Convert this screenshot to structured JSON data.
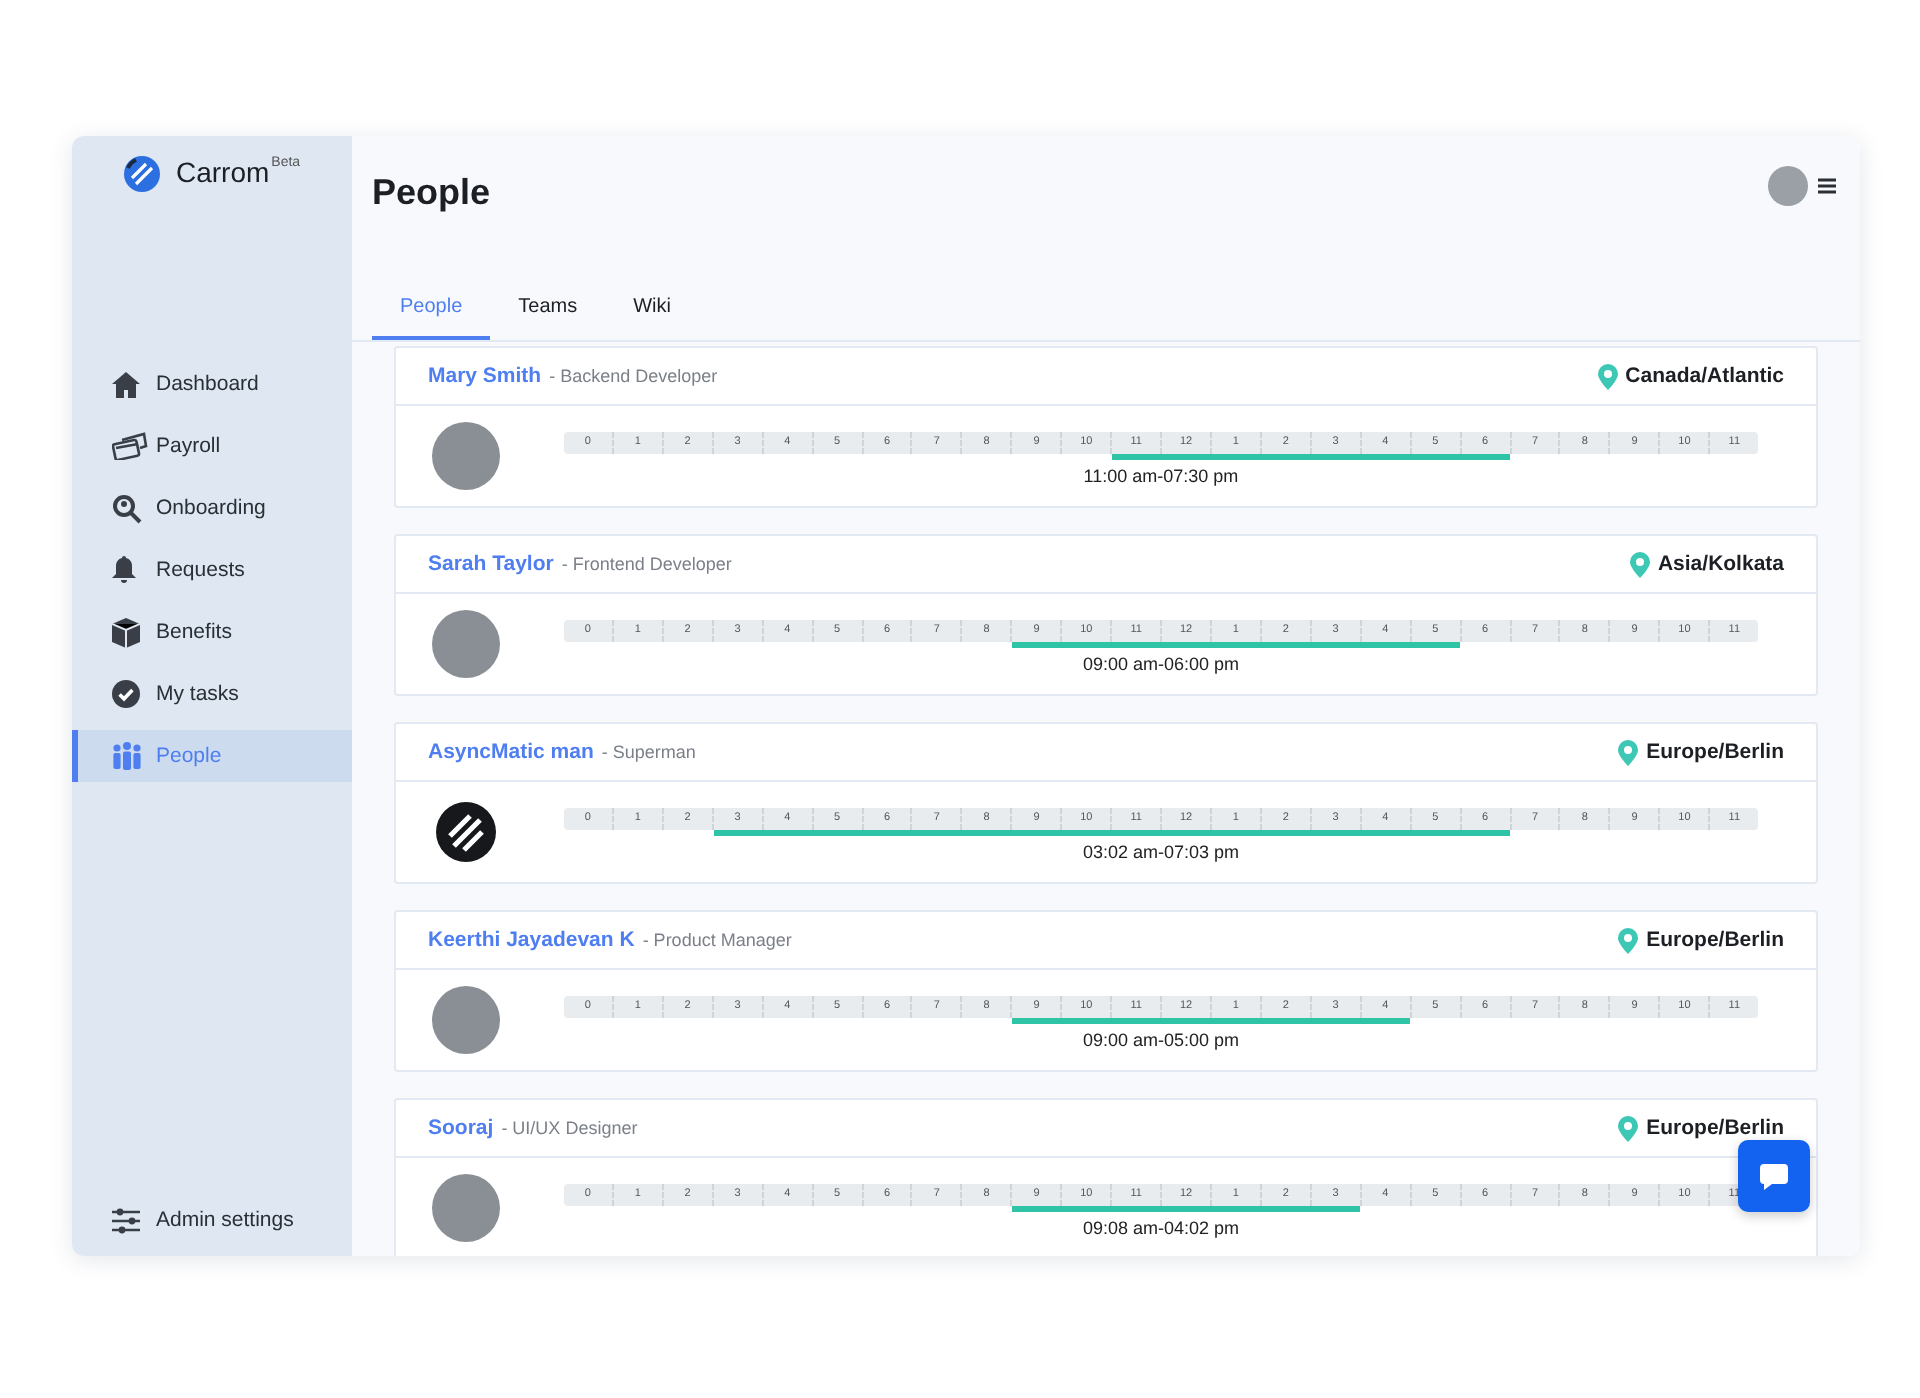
{
  "brand": {
    "name": "Carrom",
    "badge": "Beta"
  },
  "sidebar": {
    "items": [
      {
        "label": "Dashboard",
        "selected": false
      },
      {
        "label": "Payroll",
        "selected": false
      },
      {
        "label": "Onboarding",
        "selected": false
      },
      {
        "label": "Requests",
        "selected": false
      },
      {
        "label": "Benefits",
        "selected": false
      },
      {
        "label": "My tasks",
        "selected": false
      },
      {
        "label": "People",
        "selected": true
      }
    ],
    "footer": "Admin settings"
  },
  "page_title": "People",
  "tabs": [
    {
      "label": "People",
      "selected": true
    },
    {
      "label": "Teams",
      "selected": false
    },
    {
      "label": "Wiki",
      "selected": false
    }
  ],
  "people": [
    {
      "name": "Mary Smith",
      "role": "- Backend Developer",
      "timezone": "Canada/Atlantic",
      "avatar": {
        "kind": "photo"
      },
      "hours_text": "11:00 am-07:30 pm",
      "hours": [
        {
          "label": "0",
          "on": false
        },
        {
          "label": "1",
          "on": false
        },
        {
          "label": "2",
          "on": false
        },
        {
          "label": "3",
          "on": false
        },
        {
          "label": "4",
          "on": false
        },
        {
          "label": "5",
          "on": false
        },
        {
          "label": "6",
          "on": false
        },
        {
          "label": "7",
          "on": false
        },
        {
          "label": "8",
          "on": false
        },
        {
          "label": "9",
          "on": false
        },
        {
          "label": "10",
          "on": false
        },
        {
          "label": "11",
          "on": true
        },
        {
          "label": "12",
          "on": true
        },
        {
          "label": "1",
          "on": true
        },
        {
          "label": "2",
          "on": true
        },
        {
          "label": "3",
          "on": true
        },
        {
          "label": "4",
          "on": true
        },
        {
          "label": "5",
          "on": true
        },
        {
          "label": "6",
          "on": true
        },
        {
          "label": "7",
          "on": false
        },
        {
          "label": "8",
          "on": false
        },
        {
          "label": "9",
          "on": false
        },
        {
          "label": "10",
          "on": false
        },
        {
          "label": "11",
          "on": false
        }
      ]
    },
    {
      "name": "Sarah Taylor",
      "role": "- Frontend Developer",
      "timezone": "Asia/Kolkata",
      "avatar": {
        "kind": "photo"
      },
      "hours_text": "09:00 am-06:00 pm",
      "hours": [
        {
          "label": "0",
          "on": false
        },
        {
          "label": "1",
          "on": false
        },
        {
          "label": "2",
          "on": false
        },
        {
          "label": "3",
          "on": false
        },
        {
          "label": "4",
          "on": false
        },
        {
          "label": "5",
          "on": false
        },
        {
          "label": "6",
          "on": false
        },
        {
          "label": "7",
          "on": false
        },
        {
          "label": "8",
          "on": false
        },
        {
          "label": "9",
          "on": true
        },
        {
          "label": "10",
          "on": true
        },
        {
          "label": "11",
          "on": true
        },
        {
          "label": "12",
          "on": true
        },
        {
          "label": "1",
          "on": true
        },
        {
          "label": "2",
          "on": true
        },
        {
          "label": "3",
          "on": true
        },
        {
          "label": "4",
          "on": true
        },
        {
          "label": "5",
          "on": true
        },
        {
          "label": "6",
          "on": false
        },
        {
          "label": "7",
          "on": false
        },
        {
          "label": "8",
          "on": false
        },
        {
          "label": "9",
          "on": false
        },
        {
          "label": "10",
          "on": false
        },
        {
          "label": "11",
          "on": false
        }
      ]
    },
    {
      "name": "AsyncMatic man",
      "role": "- Superman",
      "timezone": "Europe/Berlin",
      "avatar": {
        "kind": "logo"
      },
      "hours_text": "03:02 am-07:03 pm",
      "hours": [
        {
          "label": "0",
          "on": false
        },
        {
          "label": "1",
          "on": false
        },
        {
          "label": "2",
          "on": false
        },
        {
          "label": "3",
          "on": true
        },
        {
          "label": "4",
          "on": true
        },
        {
          "label": "5",
          "on": true
        },
        {
          "label": "6",
          "on": true
        },
        {
          "label": "7",
          "on": true
        },
        {
          "label": "8",
          "on": true
        },
        {
          "label": "9",
          "on": true
        },
        {
          "label": "10",
          "on": true
        },
        {
          "label": "11",
          "on": true
        },
        {
          "label": "12",
          "on": true
        },
        {
          "label": "1",
          "on": true
        },
        {
          "label": "2",
          "on": true
        },
        {
          "label": "3",
          "on": true
        },
        {
          "label": "4",
          "on": true
        },
        {
          "label": "5",
          "on": true
        },
        {
          "label": "6",
          "on": true
        },
        {
          "label": "7",
          "on": false
        },
        {
          "label": "8",
          "on": false
        },
        {
          "label": "9",
          "on": false
        },
        {
          "label": "10",
          "on": false
        },
        {
          "label": "11",
          "on": false
        }
      ]
    },
    {
      "name": "Keerthi Jayadevan K",
      "role": "- Product Manager",
      "timezone": "Europe/Berlin",
      "avatar": {
        "kind": "photo"
      },
      "hours_text": "09:00 am-05:00 pm",
      "hours": [
        {
          "label": "0",
          "on": false
        },
        {
          "label": "1",
          "on": false
        },
        {
          "label": "2",
          "on": false
        },
        {
          "label": "3",
          "on": false
        },
        {
          "label": "4",
          "on": false
        },
        {
          "label": "5",
          "on": false
        },
        {
          "label": "6",
          "on": false
        },
        {
          "label": "7",
          "on": false
        },
        {
          "label": "8",
          "on": false
        },
        {
          "label": "9",
          "on": true
        },
        {
          "label": "10",
          "on": true
        },
        {
          "label": "11",
          "on": true
        },
        {
          "label": "12",
          "on": true
        },
        {
          "label": "1",
          "on": true
        },
        {
          "label": "2",
          "on": true
        },
        {
          "label": "3",
          "on": true
        },
        {
          "label": "4",
          "on": true
        },
        {
          "label": "5",
          "on": false
        },
        {
          "label": "6",
          "on": false
        },
        {
          "label": "7",
          "on": false
        },
        {
          "label": "8",
          "on": false
        },
        {
          "label": "9",
          "on": false
        },
        {
          "label": "10",
          "on": false
        },
        {
          "label": "11",
          "on": false
        }
      ]
    },
    {
      "name": "Sooraj",
      "role": "- UI/UX Designer",
      "timezone": "Europe/Berlin",
      "avatar": {
        "kind": "photo"
      },
      "hours_text": "09:08 am-04:02 pm",
      "hours": [
        {
          "label": "0",
          "on": false
        },
        {
          "label": "1",
          "on": false
        },
        {
          "label": "2",
          "on": false
        },
        {
          "label": "3",
          "on": false
        },
        {
          "label": "4",
          "on": false
        },
        {
          "label": "5",
          "on": false
        },
        {
          "label": "6",
          "on": false
        },
        {
          "label": "7",
          "on": false
        },
        {
          "label": "8",
          "on": false
        },
        {
          "label": "9",
          "on": true
        },
        {
          "label": "10",
          "on": true
        },
        {
          "label": "11",
          "on": true
        },
        {
          "label": "12",
          "on": true
        },
        {
          "label": "1",
          "on": true
        },
        {
          "label": "2",
          "on": true
        },
        {
          "label": "3",
          "on": true
        },
        {
          "label": "4",
          "on": false
        },
        {
          "label": "5",
          "on": false
        },
        {
          "label": "6",
          "on": false
        },
        {
          "label": "7",
          "on": false
        },
        {
          "label": "8",
          "on": false
        },
        {
          "label": "9",
          "on": false
        },
        {
          "label": "10",
          "on": false
        },
        {
          "label": "11",
          "on": false
        }
      ]
    }
  ]
}
